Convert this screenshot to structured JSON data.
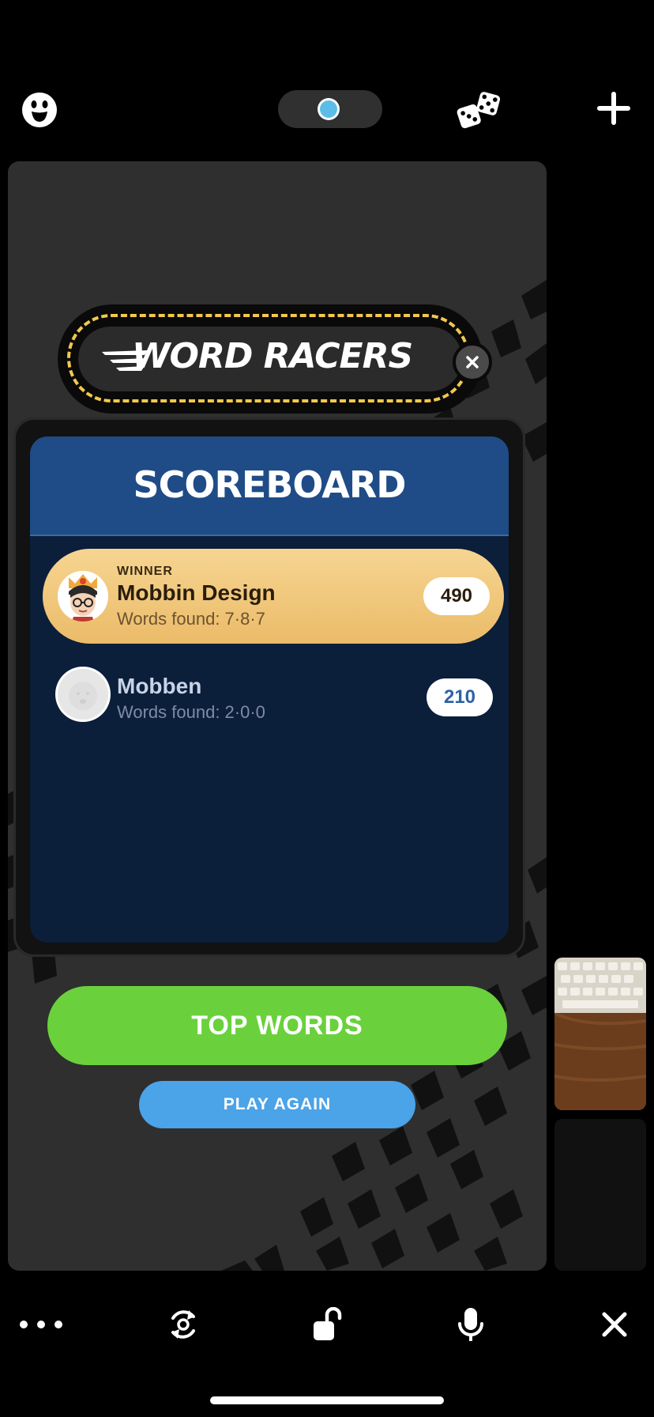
{
  "banner": {
    "title": "WORD RACERS"
  },
  "scoreboard": {
    "title": "SCOREBOARD",
    "players": [
      {
        "tag": "WINNER",
        "name": "Mobbin Design",
        "words": "Words found: 7·8·7",
        "score": "490"
      },
      {
        "tag": "",
        "name": "Mobben",
        "words": "Words found: 2·0·0",
        "score": "210"
      }
    ]
  },
  "buttons": {
    "top_words": "TOP WORDS",
    "play_again": "PLAY AGAIN"
  },
  "colors": {
    "winner_gradient": [
      "#f6d591",
      "#ebbb69"
    ],
    "board_header": "#1f4c87",
    "board_body": "#0b1e3a",
    "top_words": "#6ad13d",
    "play_again": "#4ba3e8",
    "banner_dash": "#f2c94c"
  },
  "icons": {
    "top": [
      "face-icon",
      "status-dot",
      "dice-icon",
      "plus-icon"
    ],
    "bottom": [
      "more-icon",
      "flip-camera-icon",
      "unlock-icon",
      "microphone-icon",
      "close-icon"
    ]
  }
}
